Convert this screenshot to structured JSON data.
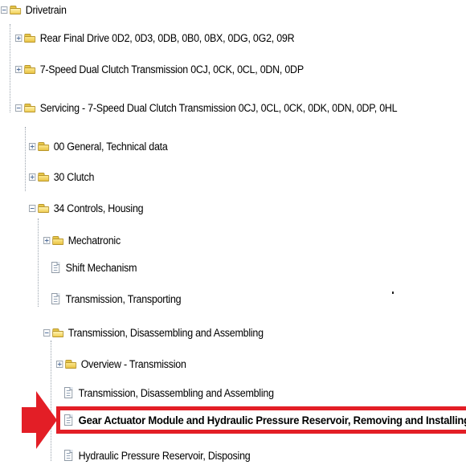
{
  "tree": {
    "items": [
      {
        "label": "Drivetrain",
        "type": "folder-open",
        "expander": "minus"
      },
      {
        "label": "Rear Final Drive 0D2, 0D3, 0DB, 0B0, 0BX, 0DG, 0G2, 09R",
        "type": "folder",
        "expander": "plus"
      },
      {
        "label": "7-Speed Dual Clutch Transmission 0CJ, 0CK, 0CL, 0DN, 0DP",
        "type": "folder",
        "expander": "plus"
      },
      {
        "label": "Servicing - 7-Speed Dual Clutch Transmission 0CJ, 0CL, 0CK, 0DK, 0DN, 0DP, 0HL",
        "type": "folder-open",
        "expander": "minus"
      },
      {
        "label": "00 General, Technical data",
        "type": "folder",
        "expander": "plus"
      },
      {
        "label": "30 Clutch",
        "type": "folder",
        "expander": "plus"
      },
      {
        "label": "34 Controls, Housing",
        "type": "folder-open",
        "expander": "minus"
      },
      {
        "label": "Mechatronic",
        "type": "folder",
        "expander": "plus"
      },
      {
        "label": "Shift Mechanism",
        "type": "document"
      },
      {
        "label": "Transmission, Transporting",
        "type": "document"
      },
      {
        "label": "Transmission, Disassembling and Assembling",
        "type": "folder-open",
        "expander": "minus"
      },
      {
        "label": "Overview - Transmission",
        "type": "folder",
        "expander": "plus"
      },
      {
        "label": "Transmission, Disassembling and Assembling",
        "type": "document"
      },
      {
        "label": "Gear Actuator Module and Hydraulic Pressure Reservoir, Removing and Installing",
        "type": "document",
        "highlighted": true
      },
      {
        "label": "Hydraulic Pressure Reservoir, Disposing",
        "type": "document"
      }
    ]
  },
  "colors": {
    "highlight": "#e31e26",
    "folder": "#f0cf55"
  }
}
